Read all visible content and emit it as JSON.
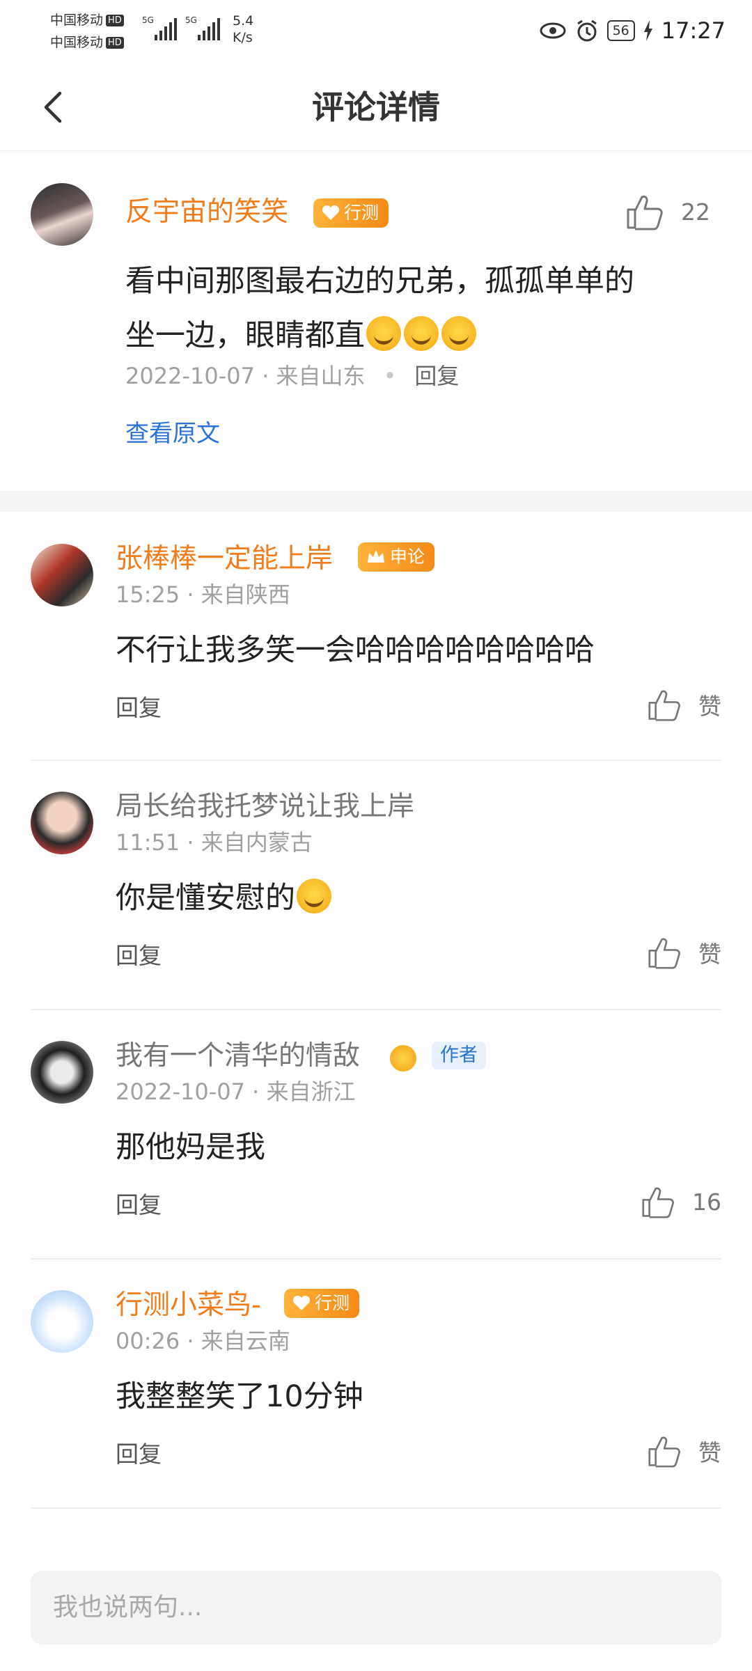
{
  "status_bar": {
    "carrier1": "中国移动",
    "carrier2": "中国移动",
    "hd": "HD",
    "net1": "5G",
    "net2": "5G",
    "speed_value": "5.4",
    "speed_unit": "K/s",
    "battery": "56",
    "time": "17:27"
  },
  "header": {
    "title": "评论详情"
  },
  "main_comment": {
    "username": "反宇宙的笑笑",
    "badge": "行测",
    "likes": "22",
    "text_line1": "看中间那图最右边的兄弟，孤孤单单的",
    "text_line2": "坐一边，眼睛都直",
    "meta": "2022-10-07 · 来自山东",
    "reply_label": "回复",
    "view_original": "查看原文"
  },
  "replies": [
    {
      "username": "张棒棒一定能上岸",
      "badge": "申论",
      "meta": "15:25 · 来自陕西",
      "text": "不行让我多笑一会哈哈哈哈哈哈哈哈",
      "reply_label": "回复",
      "like_label": "赞"
    },
    {
      "username": "局长给我托梦说让我上岸",
      "meta": "11:51 · 来自内蒙古",
      "text": "你是懂安慰的",
      "reply_label": "回复",
      "like_label": "赞"
    },
    {
      "username": "我有一个清华的情敌",
      "author_tag": "作者",
      "meta": "2022-10-07 · 来自浙江",
      "text": "那他妈是我",
      "reply_label": "回复",
      "like_label": "16"
    },
    {
      "username": "行测小菜鸟-",
      "badge": "行测",
      "meta": "00:26 · 来自云南",
      "text": "我整整笑了10分钟",
      "reply_label": "回复",
      "like_label": "赞"
    }
  ],
  "input": {
    "placeholder": "我也说两句..."
  },
  "colors": {
    "accent_orange": "#f07c1c",
    "link_blue": "#2c73d6"
  }
}
